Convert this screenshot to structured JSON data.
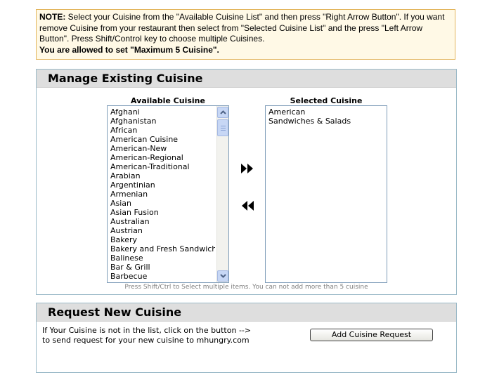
{
  "note": {
    "prefix": "NOTE:",
    "text": " Select your Cuisine from the \"Available Cuisine List\" and then press \"Right Arrow Button\". If you want remove Cuisine from your restaurant then select from \"Selected Cuisine List\" and the press \"Left Arrow Button\". Press Shift/Control key to choose multiple Cuisines.",
    "limit": "You are allowed to set \"Maximum 5 Cuisine\"."
  },
  "manage": {
    "title": "Manage Existing Cuisine",
    "available_title": "Available Cuisine",
    "selected_title": "Selected Cuisine",
    "available": [
      "Afghani",
      "Afghanistan",
      "African",
      "American Cuisine",
      "American-New",
      "American-Regional",
      "American-Traditional",
      "Arabian",
      "Argentinian",
      "Armenian",
      "Asian",
      "Asian Fusion",
      "Australian",
      "Austrian",
      "Bakery",
      "Bakery and Fresh Sandwiches",
      "Balinese",
      "Bar & Grill",
      "Barbecue"
    ],
    "selected": [
      "American",
      "Sandwiches & Salads"
    ],
    "add_icon": "double-right-arrow-icon",
    "remove_icon": "double-left-arrow-icon",
    "hint": "Press Shift/Ctrl to Select multiple items. You can not add more than 5 cuisine"
  },
  "request": {
    "title": "Request New Cuisine",
    "text": "If Your Cuisine is not in the list, click on the button -->\nto send request for your new cuisine to mhungry.com",
    "button": "Add Cuisine Request"
  }
}
